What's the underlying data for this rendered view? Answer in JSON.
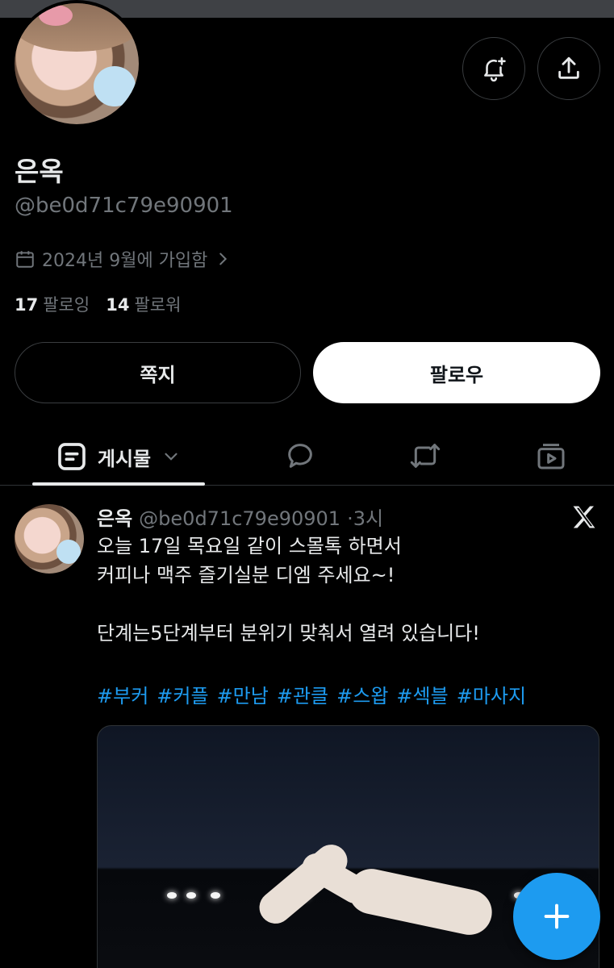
{
  "profile": {
    "name": "은옥",
    "handle": "@be0d71c79e90901",
    "joined": "2024년 9월에 가입함",
    "following_count": "17",
    "following_label": "팔로잉",
    "followers_count": "14",
    "followers_label": "팔로워"
  },
  "actions": {
    "dm_label": "쪽지",
    "follow_label": "팔로우"
  },
  "tabs": {
    "posts_label": "게시물"
  },
  "post": {
    "name": "은옥",
    "handle": "@be0d71c79e90901",
    "time": "·3시",
    "line1": "오늘 17일 목요일 같이 스몰톡 하면서",
    "line2": "커피나 맥주 즐기실분 디엠 주세요~!",
    "line3": "단계는5단계부터 분위기 맞춰서 열려 있습니다!",
    "hashtags": [
      "#부커",
      "#커플",
      "#만남",
      "#관클",
      "#스왑",
      "#섹블",
      "#마사지"
    ]
  },
  "icons": {
    "notify": "bell-plus-icon",
    "share": "share-icon",
    "calendar": "calendar-icon",
    "chevron": "chevron-right-icon",
    "posts": "posts-icon",
    "replies": "reply-bubble-icon",
    "reposts": "repost-icon",
    "media": "media-play-icon",
    "compose": "plus-icon",
    "x_logo": "x-logo-icon"
  },
  "colors": {
    "accent": "#1d9bf0",
    "background": "#000000",
    "secondary_text": "#71767b"
  }
}
